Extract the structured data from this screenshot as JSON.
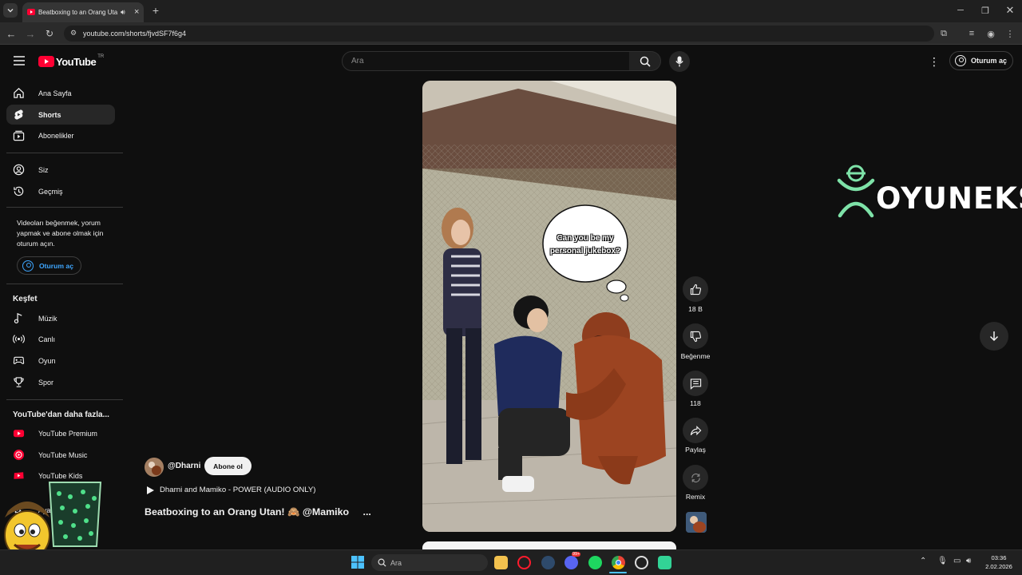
{
  "browser": {
    "tab_title": "Beatboxing to an Orang Uta",
    "url": "youtube.com/shorts/fjvdSF7f6g4"
  },
  "header": {
    "logo_text": "YouTube",
    "logo_region": "TR",
    "search_placeholder": "Ara",
    "signin_label": "Oturum aç"
  },
  "sidebar": {
    "primary": [
      {
        "label": "Ana Sayfa",
        "icon": "home-icon"
      },
      {
        "label": "Shorts",
        "icon": "shorts-icon"
      },
      {
        "label": "Abonelikler",
        "icon": "subscriptions-icon"
      }
    ],
    "you": [
      {
        "label": "Siz",
        "icon": "account-icon"
      },
      {
        "label": "Geçmiş",
        "icon": "history-icon"
      }
    ],
    "promo_text": "Videoları beğenmek, yorum yapmak ve abone olmak için oturum açın.",
    "signin_label": "Oturum aç",
    "explore_title": "Keşfet",
    "explore": [
      {
        "label": "Müzik",
        "icon": "music-icon"
      },
      {
        "label": "Canlı",
        "icon": "live-icon"
      },
      {
        "label": "Oyun",
        "icon": "gaming-icon"
      },
      {
        "label": "Spor",
        "icon": "trophy-icon"
      }
    ],
    "more_title": "YouTube'dan daha fazla...",
    "more": [
      {
        "label": "YouTube Premium",
        "icon": "youtube-premium-icon"
      },
      {
        "label": "YouTube Music",
        "icon": "youtube-music-icon"
      },
      {
        "label": "YouTube Kids",
        "icon": "youtube-kids-icon"
      }
    ],
    "settings_partial": "Aya"
  },
  "short": {
    "speech_bubble": "Can you be my personal jukebox?",
    "channel": "@Dharni",
    "subscribe_label": "Abone ol",
    "audio": "Dharni and Mamiko - POWER (AUDIO ONLY)",
    "title": "Beatboxing to an Orang Utan! 🙈 @Mamiko",
    "title_ellipsis": "...",
    "actions": {
      "like_count": "18 B",
      "dislike_label": "Beğenme",
      "comment_count": "118",
      "share_label": "Paylaş",
      "remix_label": "Remix"
    }
  },
  "watermark": "OYUNEKS",
  "taskbar": {
    "search_placeholder": "Ara",
    "time": "03:36",
    "date": "2.02.2026",
    "notification_badge": "99+"
  },
  "colors": {
    "youtube_red": "#ff0033",
    "link_blue": "#3ea6ff",
    "watermark_green": "#7ee2a8"
  }
}
